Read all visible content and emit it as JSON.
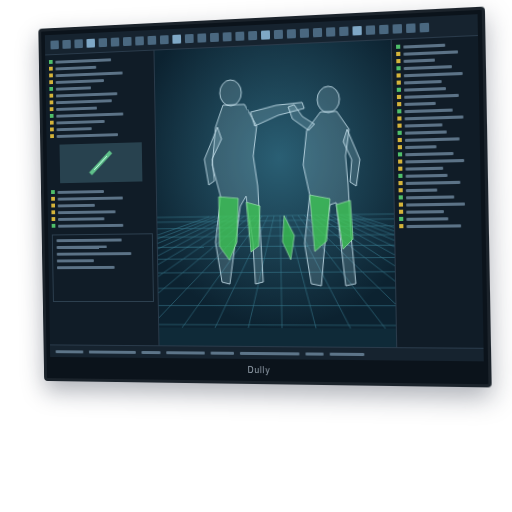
{
  "monitor": {
    "brand": "Dully"
  }
}
